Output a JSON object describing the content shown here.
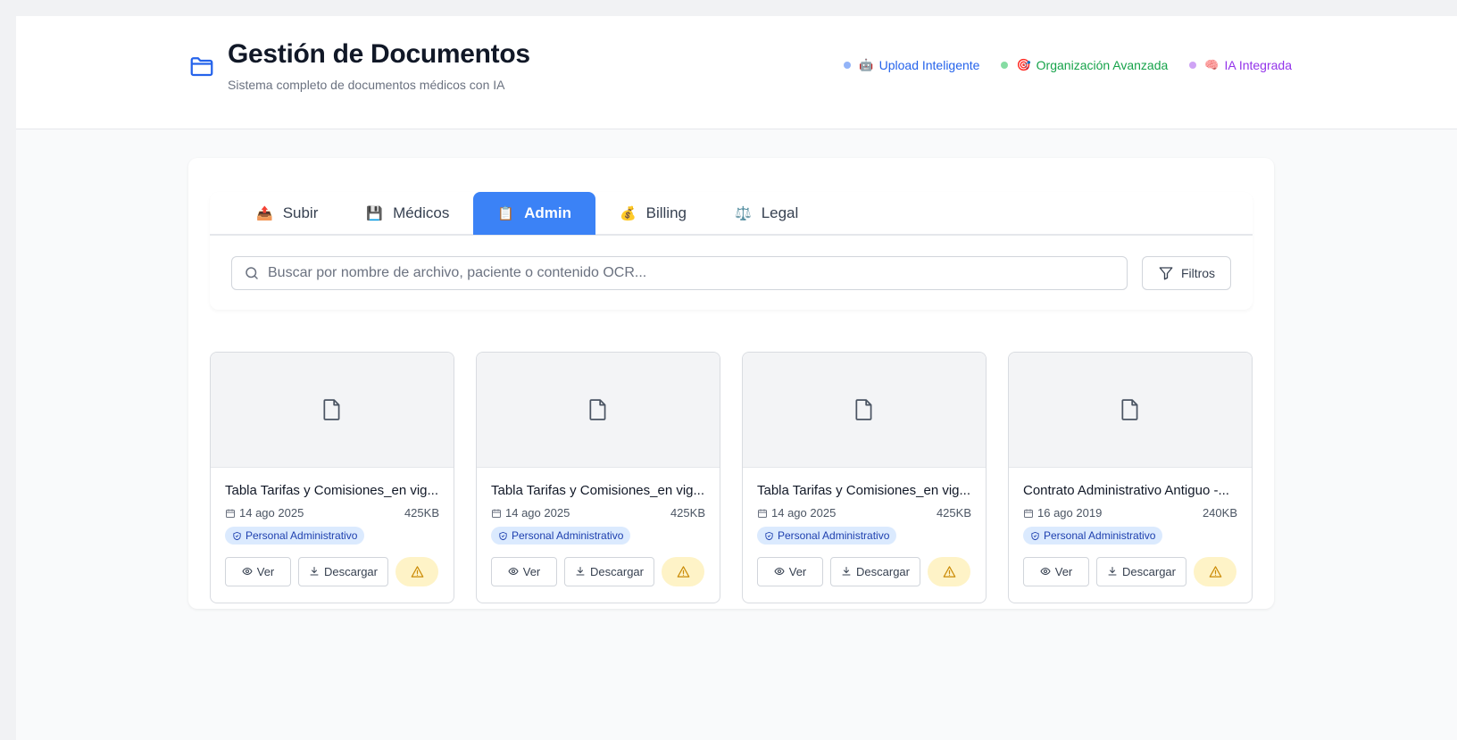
{
  "header": {
    "title": "Gestión de Documentos",
    "subtitle": "Sistema completo de documentos médicos con IA",
    "features": [
      {
        "emoji": "🤖",
        "label": "Upload Inteligente",
        "color": "#2563eb",
        "dot": "#93b4f8"
      },
      {
        "emoji": "🎯",
        "label": "Organización Avanzada",
        "color": "#16a34a",
        "dot": "#86dca3"
      },
      {
        "emoji": "🧠",
        "label": "IA Integrada",
        "color": "#9333ea",
        "dot": "#cfa3f5"
      }
    ]
  },
  "tabs": [
    {
      "emoji": "📤",
      "label": "Subir",
      "active": false
    },
    {
      "emoji": "💾",
      "label": "Médicos",
      "active": false
    },
    {
      "emoji": "📋",
      "label": "Admin",
      "active": true
    },
    {
      "emoji": "💰",
      "label": "Billing",
      "active": false
    },
    {
      "emoji": "⚖️",
      "label": "Legal",
      "active": false
    }
  ],
  "search": {
    "placeholder": "Buscar por nombre de archivo, paciente o contenido OCR...",
    "value": ""
  },
  "filters_label": "Filtros",
  "documents": [
    {
      "title": "Tabla Tarifas y Comisiones_en vig...",
      "date": "14 ago 2025",
      "size": "425KB",
      "category": "Personal Administrativo",
      "view_label": "Ver",
      "download_label": "Descargar"
    },
    {
      "title": "Tabla Tarifas y Comisiones_en vig...",
      "date": "14 ago 2025",
      "size": "425KB",
      "category": "Personal Administrativo",
      "view_label": "Ver",
      "download_label": "Descargar"
    },
    {
      "title": "Tabla Tarifas y Comisiones_en vig...",
      "date": "14 ago 2025",
      "size": "425KB",
      "category": "Personal Administrativo",
      "view_label": "Ver",
      "download_label": "Descargar"
    },
    {
      "title": "Contrato Administrativo Antiguo -...",
      "date": "16 ago 2019",
      "size": "240KB",
      "category": "Personal Administrativo",
      "view_label": "Ver",
      "download_label": "Descargar"
    }
  ],
  "icons": {
    "header": "folder-icon",
    "search": "search-icon",
    "filters": "filter-icon",
    "thumbnail": "file-icon",
    "date": "calendar-icon",
    "badge": "shield-icon",
    "view": "eye-icon",
    "download": "download-icon",
    "warning": "warning-icon"
  },
  "colors": {
    "accent": "#3b82f6",
    "badge_bg": "#dbeafe",
    "badge_text": "#1e40af",
    "warning_bg": "#fef3c7",
    "warning_icon": "#ca8a04"
  }
}
